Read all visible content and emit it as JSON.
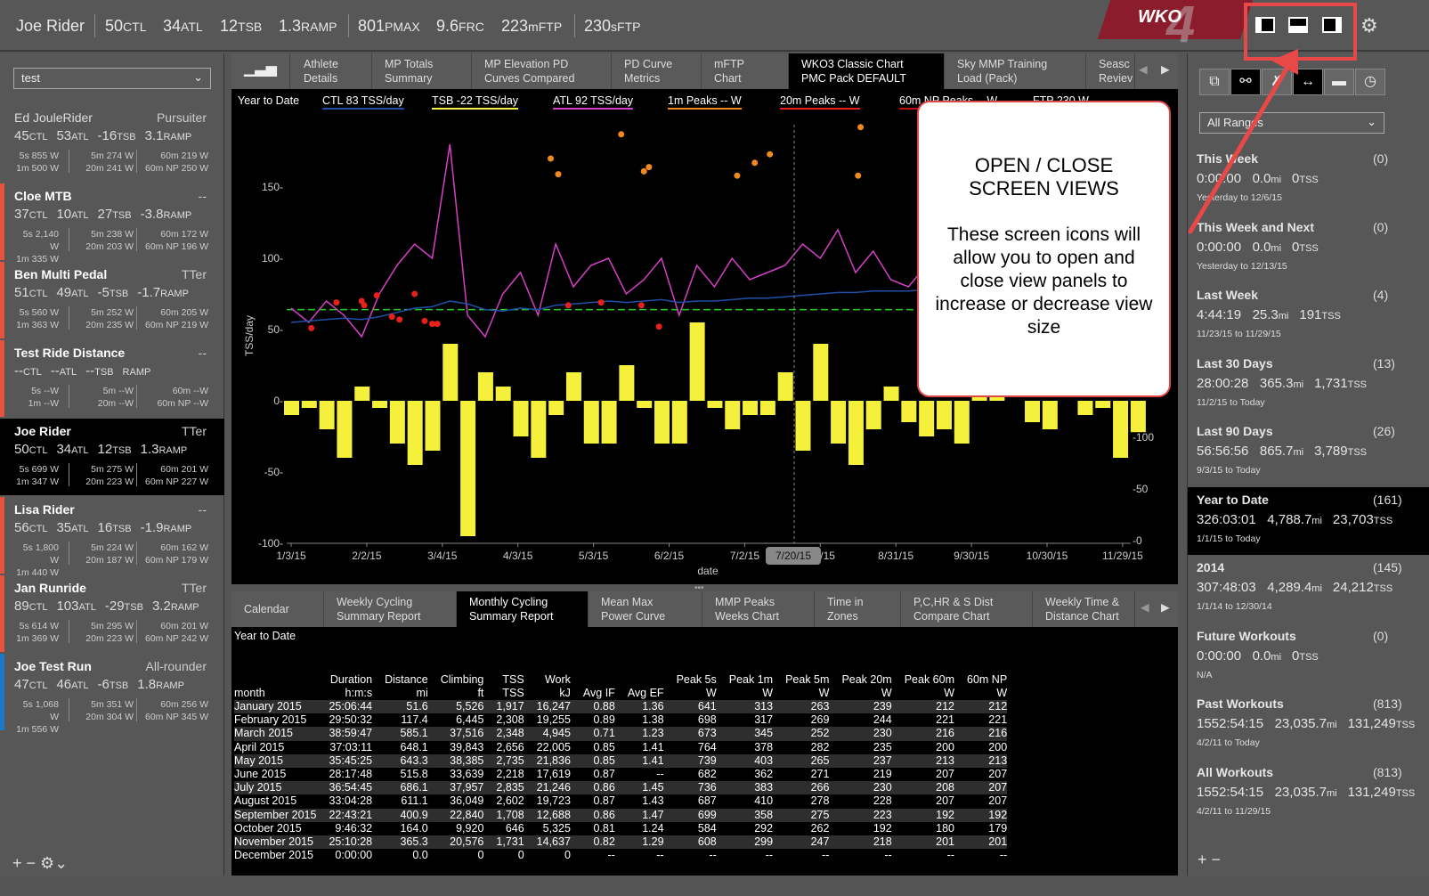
{
  "topbar": {
    "athlete": "Joe Rider",
    "ctl": "50",
    "ctl_u": "CTL",
    "atl": "34",
    "atl_u": "ATL",
    "tsb": "12",
    "tsb_u": "TSB",
    "ramp": "1.3",
    "ramp_u": "RAMP",
    "pmax": "801",
    "pmax_u": "PMAX",
    "frc": "9.6",
    "frc_u": "FRC",
    "mftp": "223",
    "mftp_u": "mFTP",
    "sftp": "230",
    "sftp_u": "sFTP",
    "logo": "WKO4"
  },
  "sidebar": {
    "select": "test",
    "athletes": [
      {
        "name": "Ed JouleRider",
        "type": "Pursuiter",
        "ctl": "45",
        "atl": "53",
        "tsb": "-16",
        "ramp": "3.1",
        "p5s": "5s 855 W",
        "p1m": "1m 500 W",
        "p5m": "5m 274 W",
        "p20m": "20m 241 W",
        "p60m": "60m 219 W",
        "np": "60m NP 250 W",
        "bar": ""
      },
      {
        "name": "Cloe MTB",
        "type": "--",
        "ctl": "37",
        "atl": "10",
        "tsb": "27",
        "ramp": "-3.8",
        "p5s": "5s 2,140 W",
        "p1m": "1m 335 W",
        "p5m": "5m 238 W",
        "p20m": "20m 203 W",
        "p60m": "60m 172 W",
        "np": "60m NP 196 W",
        "bar": "#e8503f"
      },
      {
        "name": "Ben Multi Pedal",
        "type": "TTer",
        "ctl": "51",
        "atl": "49",
        "tsb": "-5",
        "ramp": "-1.7",
        "p5s": "5s 560 W",
        "p1m": "1m 363 W",
        "p5m": "5m 252 W",
        "p20m": "20m 235 W",
        "p60m": "60m 205 W",
        "np": "60m NP 219 W",
        "bar": "#e8503f"
      },
      {
        "name": "Test Ride Distance",
        "type": "--",
        "ctl": "--",
        "atl": "--",
        "tsb": "--",
        "ramp": "",
        "p5s": "5s --W",
        "p1m": "1m --W",
        "p5m": "5m --W",
        "p20m": "20m --W",
        "p60m": "60m --W",
        "np": "60m NP --W",
        "bar": "#e8503f"
      },
      {
        "name": "Joe Rider",
        "type": "TTer",
        "ctl": "50",
        "atl": "34",
        "tsb": "12",
        "ramp": "1.3",
        "p5s": "5s 699 W",
        "p1m": "1m 347 W",
        "p5m": "5m 275 W",
        "p20m": "20m 223 W",
        "p60m": "60m 201 W",
        "np": "60m NP 227 W",
        "bar": "",
        "selected": true
      },
      {
        "name": "Lisa Rider",
        "type": "--",
        "ctl": "56",
        "atl": "35",
        "tsb": "16",
        "ramp": "-1.9",
        "p5s": "5s 1,800 W",
        "p1m": "1m 440 W",
        "p5m": "5m 224 W",
        "p20m": "20m 187 W",
        "p60m": "60m 162 W",
        "np": "60m NP 179 W",
        "bar": "#e8503f"
      },
      {
        "name": "Jan Runride",
        "type": "TTer",
        "ctl": "89",
        "atl": "103",
        "tsb": "-29",
        "ramp": "3.2",
        "p5s": "5s 614 W",
        "p1m": "1m 369 W",
        "p5m": "5m 295 W",
        "p20m": "20m 223 W",
        "p60m": "60m 201 W",
        "np": "60m NP 242 W",
        "bar": "#e8503f"
      },
      {
        "name": "Joe Test Run",
        "type": "All-rounder",
        "ctl": "47",
        "atl": "46",
        "tsb": "-6",
        "ramp": "1.8",
        "p5s": "5s 1,068 W",
        "p1m": "1m 556 W",
        "p5m": "5m 351 W",
        "p20m": "20m 304 W",
        "p60m": "60m 256 W",
        "np": "60m NP 345 W",
        "bar": "#1a78c8"
      }
    ],
    "units": {
      "ctl": "CTL",
      "atl": "ATL",
      "tsb": "TSB",
      "ramp": "RAMP"
    },
    "footer": "+ − ⚙⌄"
  },
  "chart_tabs": [
    {
      "label": "Athlete\nDetails"
    },
    {
      "label": "MP Totals\nSummary"
    },
    {
      "label": "MP Elevation PD\nCurves Compared"
    },
    {
      "label": "PD Curve\nMetrics"
    },
    {
      "label": "mFTP\nChart"
    },
    {
      "label": "WKO3 Classic Chart\nPMC Pack DEFAULT",
      "active": true
    },
    {
      "label": "Sky MMP Training\nLoad (Pack)"
    },
    {
      "label": "Seasc\nReviev"
    }
  ],
  "legend": {
    "range": "Year to Date",
    "ctl": "CTL  83 TSS/day",
    "tsb": "TSB  -22 TSS/day",
    "atl": "ATL  92 TSS/day",
    "p1m": "1m Peaks  -- W",
    "p20m": "20m Peaks  -- W",
    "p60np": "60m NP Peaks  -- W",
    "ftp": "FTP  230 W"
  },
  "colors": {
    "ctl": "#1f4fa8",
    "tsb": "#f5f03c",
    "atl": "#d63fc8",
    "p1m": "#f08a20",
    "p20m": "#e8201c",
    "ftp": "#22cc22",
    "accent": "#e04848"
  },
  "chart_data": {
    "type": "line",
    "xlabel": "date",
    "ylabel": "TSS/day",
    "ylim": [
      -100,
      160
    ],
    "yticks": [
      "150-",
      "100-",
      "50-",
      "0-",
      "-50-",
      "-100-"
    ],
    "right_ticks": [
      "-100",
      "-50",
      "-0"
    ],
    "xticks": [
      "1/3/15",
      "2/2/15",
      "3/4/15",
      "4/3/15",
      "5/3/15",
      "6/2/15",
      "7/2/15",
      "8/1/15",
      "8/31/15",
      "9/30/15",
      "10/30/15",
      "11/29/15"
    ],
    "cursor": "7/20/15",
    "grid": false,
    "dates": [
      "2015-01-03",
      "2015-01-10",
      "2015-01-17",
      "2015-01-24",
      "2015-01-31",
      "2015-02-07",
      "2015-02-14",
      "2015-02-21",
      "2015-02-28",
      "2015-03-07",
      "2015-03-14",
      "2015-03-21",
      "2015-03-28",
      "2015-04-04",
      "2015-04-11",
      "2015-04-18",
      "2015-04-25",
      "2015-05-02",
      "2015-05-09",
      "2015-05-16",
      "2015-05-23",
      "2015-05-30",
      "2015-06-06",
      "2015-06-13",
      "2015-06-20",
      "2015-06-27",
      "2015-07-04",
      "2015-07-11",
      "2015-07-18",
      "2015-07-25",
      "2015-08-01",
      "2015-08-08",
      "2015-08-15",
      "2015-08-22",
      "2015-08-29",
      "2015-09-05",
      "2015-09-12",
      "2015-09-19",
      "2015-09-26",
      "2015-10-03",
      "2015-10-10",
      "2015-10-17",
      "2015-10-24",
      "2015-10-31",
      "2015-11-07",
      "2015-11-14",
      "2015-11-21",
      "2015-11-28",
      "2015-12-05"
    ],
    "series": [
      {
        "name": "ATL",
        "type": "line",
        "values": [
          65,
          55,
          70,
          60,
          45,
          75,
          95,
          110,
          100,
          180,
          60,
          45,
          75,
          90,
          60,
          110,
          80,
          95,
          100,
          75,
          85,
          100,
          60,
          95,
          80,
          100,
          85,
          90,
          95,
          110,
          100,
          120,
          90,
          105,
          85,
          80,
          95,
          100,
          110,
          70,
          60,
          75,
          90,
          80,
          85,
          80,
          75,
          95,
          92
        ]
      },
      {
        "name": "CTL",
        "type": "line",
        "values": [
          55,
          56,
          57,
          58,
          57,
          59,
          62,
          65,
          66,
          70,
          68,
          64,
          63,
          65,
          64,
          67,
          68,
          69,
          70,
          69,
          70,
          71,
          69,
          70,
          70,
          71,
          72,
          72,
          73,
          74,
          75,
          76,
          76,
          77,
          77,
          77,
          78,
          78,
          79,
          78,
          76,
          75,
          75,
          76,
          76,
          77,
          77,
          80,
          83
        ]
      },
      {
        "name": "TSB",
        "type": "bar",
        "values": [
          -10,
          -5,
          -20,
          -40,
          10,
          -5,
          -30,
          -45,
          -35,
          40,
          -95,
          20,
          10,
          -25,
          -40,
          -10,
          20,
          -30,
          -30,
          25,
          -5,
          -30,
          -30,
          55,
          -5,
          -20,
          -10,
          -10,
          20,
          -35,
          40,
          -30,
          -45,
          -20,
          10,
          -15,
          -25,
          -20,
          -30,
          10,
          20,
          0,
          -15,
          -20,
          0,
          -10,
          -5,
          -40,
          -22
        ]
      }
    ],
    "ftp_level": 64,
    "peaks_1m": [
      [
        "2015-04-16",
        170
      ],
      [
        "2015-04-19",
        159
      ],
      [
        "2015-05-14",
        187
      ],
      [
        "2015-05-23",
        161
      ],
      [
        "2015-05-25",
        164
      ],
      [
        "2015-06-29",
        158
      ],
      [
        "2015-07-06",
        167
      ],
      [
        "2015-07-12",
        173
      ],
      [
        "2015-08-16",
        158
      ],
      [
        "2015-08-17",
        192
      ]
    ],
    "peaks_20m": [
      [
        "2015-01-11",
        51
      ],
      [
        "2015-01-21",
        69
      ],
      [
        "2015-01-31",
        70
      ],
      [
        "2015-02-01",
        67
      ],
      [
        "2015-02-06",
        74
      ],
      [
        "2015-02-12",
        59
      ],
      [
        "2015-02-15",
        57
      ],
      [
        "2015-02-21",
        75
      ],
      [
        "2015-02-25",
        56
      ],
      [
        "2015-02-28",
        54
      ],
      [
        "2015-03-02",
        54
      ],
      [
        "2015-04-23",
        67
      ],
      [
        "2015-05-06",
        69
      ],
      [
        "2015-05-22",
        67
      ],
      [
        "2015-05-29",
        52
      ]
    ]
  },
  "bottom_tabs": [
    {
      "label": "Calendar"
    },
    {
      "label": "Weekly Cycling\nSummary Report"
    },
    {
      "label": "Monthly Cycling\nSummary Report",
      "active": true
    },
    {
      "label": "Mean Max\nPower Curve"
    },
    {
      "label": "MMP Peaks\nWeeks Chart"
    },
    {
      "label": "Time in\nZones"
    },
    {
      "label": "P,C,HR & S Dist\nCompare Chart"
    },
    {
      "label": "Weekly Time &\nDistance Chart"
    }
  ],
  "report": {
    "title": "Year to Date",
    "headers": [
      [
        "",
        "month"
      ],
      [
        "Duration",
        "h:m:s"
      ],
      [
        "Distance",
        "mi"
      ],
      [
        "Climbing",
        "ft"
      ],
      [
        "TSS",
        "TSS"
      ],
      [
        "Work",
        "kJ"
      ],
      [
        "Avg IF",
        ""
      ],
      [
        "Avg EF",
        ""
      ],
      [
        "Peak 5s",
        "W"
      ],
      [
        "Peak 1m",
        "W"
      ],
      [
        "Peak 5m",
        "W"
      ],
      [
        "Peak 20m",
        "W"
      ],
      [
        "Peak 60m",
        "W"
      ],
      [
        "60m NP",
        "W"
      ]
    ],
    "rows": [
      [
        "January 2015",
        "25:06:44",
        "51.6",
        "5,526",
        "1,917",
        "16,247",
        "0.88",
        "1.36",
        "641",
        "313",
        "263",
        "239",
        "212",
        "212"
      ],
      [
        "February 2015",
        "29:50:32",
        "117.4",
        "6,445",
        "2,308",
        "19,255",
        "0.89",
        "1.38",
        "698",
        "317",
        "269",
        "244",
        "221",
        "221"
      ],
      [
        "March 2015",
        "38:59:47",
        "585.1",
        "37,516",
        "2,348",
        "4,945",
        "0.71",
        "1.23",
        "673",
        "345",
        "252",
        "230",
        "216",
        "216"
      ],
      [
        "April 2015",
        "37:03:11",
        "648.1",
        "39,843",
        "2,656",
        "22,005",
        "0.85",
        "1.41",
        "764",
        "378",
        "282",
        "235",
        "200",
        "200"
      ],
      [
        "May 2015",
        "35:45:25",
        "643.3",
        "38,385",
        "2,735",
        "21,836",
        "0.85",
        "1.41",
        "739",
        "403",
        "265",
        "237",
        "213",
        "213"
      ],
      [
        "June 2015",
        "28:17:48",
        "515.8",
        "33,639",
        "2,218",
        "17,619",
        "0.87",
        "--",
        "682",
        "362",
        "271",
        "219",
        "207",
        "207"
      ],
      [
        "July 2015",
        "36:54:45",
        "686.1",
        "37,957",
        "2,835",
        "21,246",
        "0.86",
        "1.45",
        "736",
        "383",
        "266",
        "230",
        "208",
        "207"
      ],
      [
        "August 2015",
        "33:04:28",
        "611.1",
        "36,049",
        "2,602",
        "19,723",
        "0.87",
        "1.43",
        "687",
        "410",
        "278",
        "228",
        "207",
        "207"
      ],
      [
        "September 2015",
        "22:43:21",
        "400.9",
        "22,840",
        "1,708",
        "12,688",
        "0.86",
        "1.47",
        "699",
        "358",
        "275",
        "223",
        "192",
        "192"
      ],
      [
        "October 2015",
        "9:46:32",
        "164.0",
        "9,920",
        "646",
        "5,325",
        "0.81",
        "1.24",
        "584",
        "292",
        "262",
        "192",
        "180",
        "179"
      ],
      [
        "November 2015",
        "25:10:28",
        "365.3",
        "20,576",
        "1,731",
        "14,637",
        "0.82",
        "1.29",
        "608",
        "299",
        "247",
        "218",
        "201",
        "201"
      ],
      [
        "December 2015",
        "0:00:00",
        "0.0",
        "0",
        "0",
        "0",
        "--",
        "--",
        "--",
        "--",
        "--",
        "--",
        "--",
        "--"
      ]
    ]
  },
  "right": {
    "select": "All Ranges",
    "ranges": [
      {
        "title": "This Week",
        "count": "(0)",
        "time": "0:00:00",
        "dist": "0.0",
        "tss": "0",
        "dates": "Yesterday  to  12/6/15"
      },
      {
        "title": "This Week and Next",
        "count": "(0)",
        "time": "0:00:00",
        "dist": "0.0",
        "tss": "0",
        "dates": "Yesterday  to  12/13/15"
      },
      {
        "title": "Last Week",
        "count": "(4)",
        "time": "4:44:19",
        "dist": "25.3",
        "tss": "191",
        "dates": "11/23/15  to  11/29/15"
      },
      {
        "title": "Last 30 Days",
        "count": "(13)",
        "time": "28:00:28",
        "dist": "365.3",
        "tss": "1,731",
        "dates": "11/2/15  to  Today"
      },
      {
        "title": "Last 90 Days",
        "count": "(26)",
        "time": "56:56:56",
        "dist": "865.7",
        "tss": "3,789",
        "dates": "9/3/15  to  Today"
      },
      {
        "title": "Year to Date",
        "count": "(161)",
        "time": "326:03:01",
        "dist": "4,788.7",
        "tss": "23,703",
        "dates": "1/1/15  to  Today",
        "selected": true
      },
      {
        "title": "2014",
        "count": "(145)",
        "time": "307:48:03",
        "dist": "4,289.4",
        "tss": "24,212",
        "dates": "1/1/14  to  12/30/14"
      },
      {
        "title": "Future Workouts",
        "count": "(0)",
        "time": "0:00:00",
        "dist": "0.0",
        "tss": "0",
        "dates": "N/A"
      },
      {
        "title": "Past Workouts",
        "count": "(813)",
        "time": "1552:54:15",
        "dist": "23,035.7",
        "tss": "131,249",
        "dates": "4/2/11  to  Today"
      },
      {
        "title": "All Workouts",
        "count": "(813)",
        "time": "1552:54:15",
        "dist": "23,035.7",
        "tss": "131,249",
        "dates": "4/2/11  to  11/29/15"
      }
    ],
    "mi": "mi",
    "tss": "TSS",
    "footer": "+ −"
  },
  "callout": {
    "heading": "OPEN / CLOSE\nSCREEN VIEWS",
    "body": "These screen icons will allow you to open and close view panels to increase or decrease view size"
  }
}
